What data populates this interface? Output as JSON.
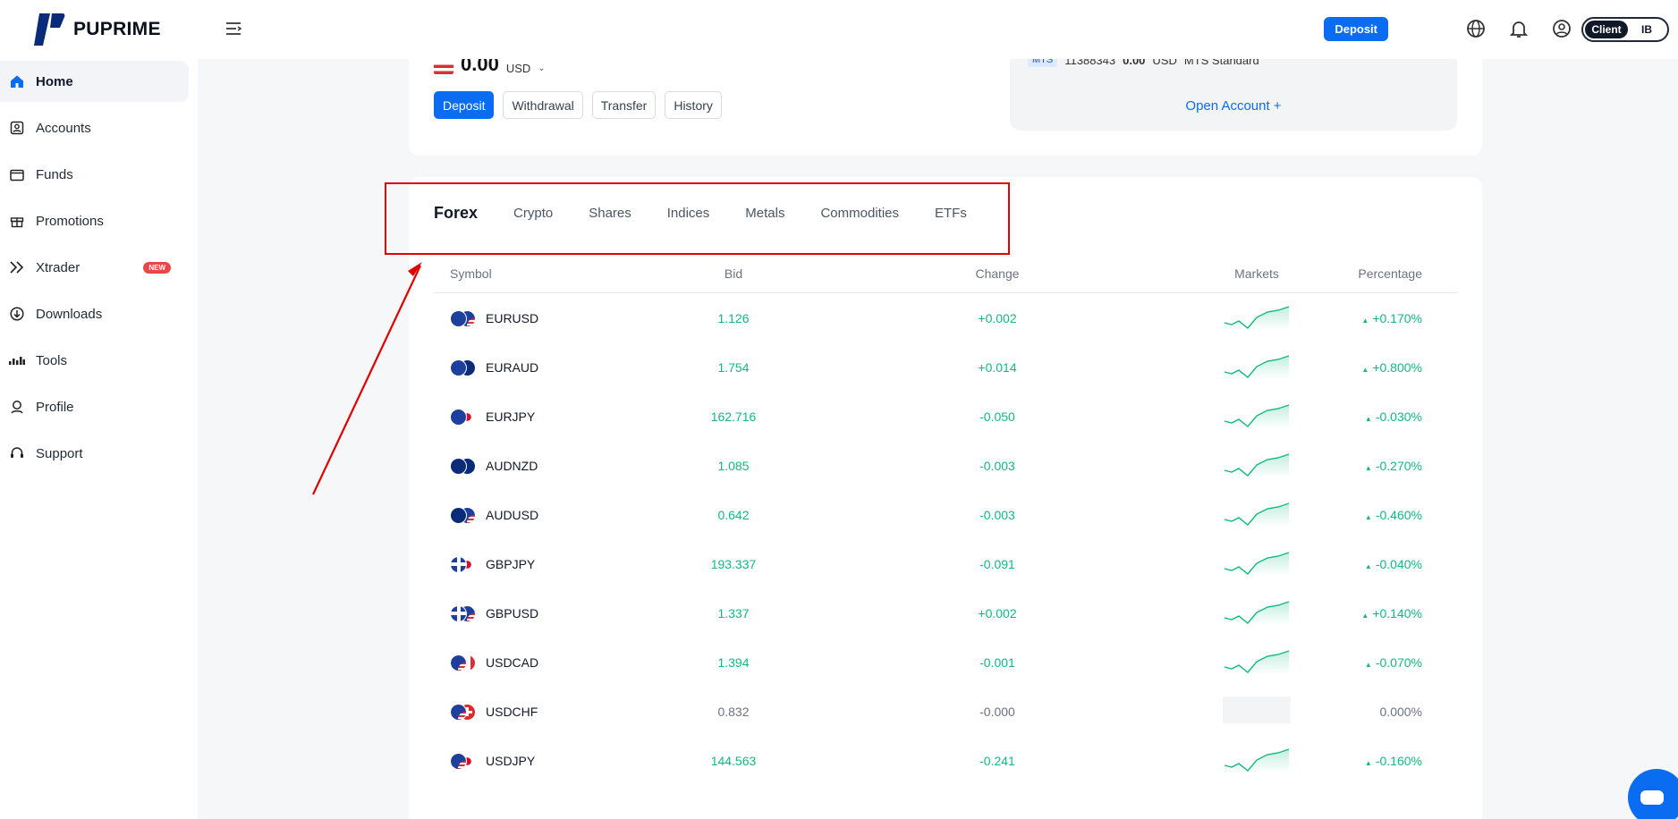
{
  "brand": {
    "name": "PUPRIME"
  },
  "sidebar": {
    "items": [
      {
        "label": "Home",
        "icon": "home-icon",
        "active": true
      },
      {
        "label": "Accounts",
        "icon": "accounts-icon"
      },
      {
        "label": "Funds",
        "icon": "wallet-icon"
      },
      {
        "label": "Promotions",
        "icon": "gift-icon"
      },
      {
        "label": "Xtrader",
        "icon": "xtrader-icon",
        "badge": "NEW"
      },
      {
        "label": "Downloads",
        "icon": "download-icon"
      },
      {
        "label": "Tools",
        "icon": "tools-icon"
      },
      {
        "label": "Profile",
        "icon": "profile-icon"
      },
      {
        "label": "Support",
        "icon": "headset-icon"
      }
    ]
  },
  "topbar": {
    "deposit_label": "Deposit",
    "toggle_on": "Client",
    "toggle_off": "IB"
  },
  "account": {
    "balance": "0.00",
    "currency": "USD",
    "buttons": [
      "Deposit",
      "Withdrawal",
      "Transfer",
      "History"
    ],
    "sub_tag": "MTS",
    "sub_number": "11388343",
    "sub_amount": "0.00",
    "sub_currency": "USD",
    "sub_type": "MTS Standard",
    "open_account": "Open Account +"
  },
  "market": {
    "tabs": [
      "Forex",
      "Crypto",
      "Shares",
      "Indices",
      "Metals",
      "Commodities",
      "ETFs"
    ],
    "active_tab": "Forex",
    "columns": [
      "Symbol",
      "Bid",
      "Change",
      "Markets",
      "Percentage"
    ],
    "rows": [
      {
        "symbol": "EURUSD",
        "bid": "1.126",
        "change": "+0.002",
        "pct": "+0.170%",
        "trend": "up",
        "f1": "#1d3f9e",
        "f2": "us"
      },
      {
        "symbol": "EURAUD",
        "bid": "1.754",
        "change": "+0.014",
        "pct": "+0.800%",
        "trend": "up",
        "f1": "#1d3f9e",
        "f2": "#0a2a7a"
      },
      {
        "symbol": "EURJPY",
        "bid": "162.716",
        "change": "-0.050",
        "pct": "-0.030%",
        "trend": "up",
        "f1": "#1d3f9e",
        "f2": "jp"
      },
      {
        "symbol": "AUDNZD",
        "bid": "1.085",
        "change": "-0.003",
        "pct": "-0.270%",
        "trend": "up",
        "f1": "#0a2a7a",
        "f2": "#0a2a7a"
      },
      {
        "symbol": "AUDUSD",
        "bid": "0.642",
        "change": "-0.003",
        "pct": "-0.460%",
        "trend": "up",
        "f1": "#0a2a7a",
        "f2": "us"
      },
      {
        "symbol": "GBPJPY",
        "bid": "193.337",
        "change": "-0.091",
        "pct": "-0.040%",
        "trend": "up",
        "f1": "gb",
        "f2": "jp"
      },
      {
        "symbol": "GBPUSD",
        "bid": "1.337",
        "change": "+0.002",
        "pct": "+0.140%",
        "trend": "up",
        "f1": "gb",
        "f2": "us"
      },
      {
        "symbol": "USDCAD",
        "bid": "1.394",
        "change": "-0.001",
        "pct": "-0.070%",
        "trend": "up",
        "f1": "us",
        "f2": "ca"
      },
      {
        "symbol": "USDCHF",
        "bid": "0.832",
        "change": "-0.000",
        "pct": "0.000%",
        "trend": "flat",
        "f1": "us",
        "f2": "ch"
      },
      {
        "symbol": "USDJPY",
        "bid": "144.563",
        "change": "-0.241",
        "pct": "-0.160%",
        "trend": "up",
        "f1": "us",
        "f2": "jp"
      }
    ]
  },
  "colors": {
    "accent": "#0a6cf0",
    "positive": "#10b981",
    "highlight": "#e00000"
  }
}
